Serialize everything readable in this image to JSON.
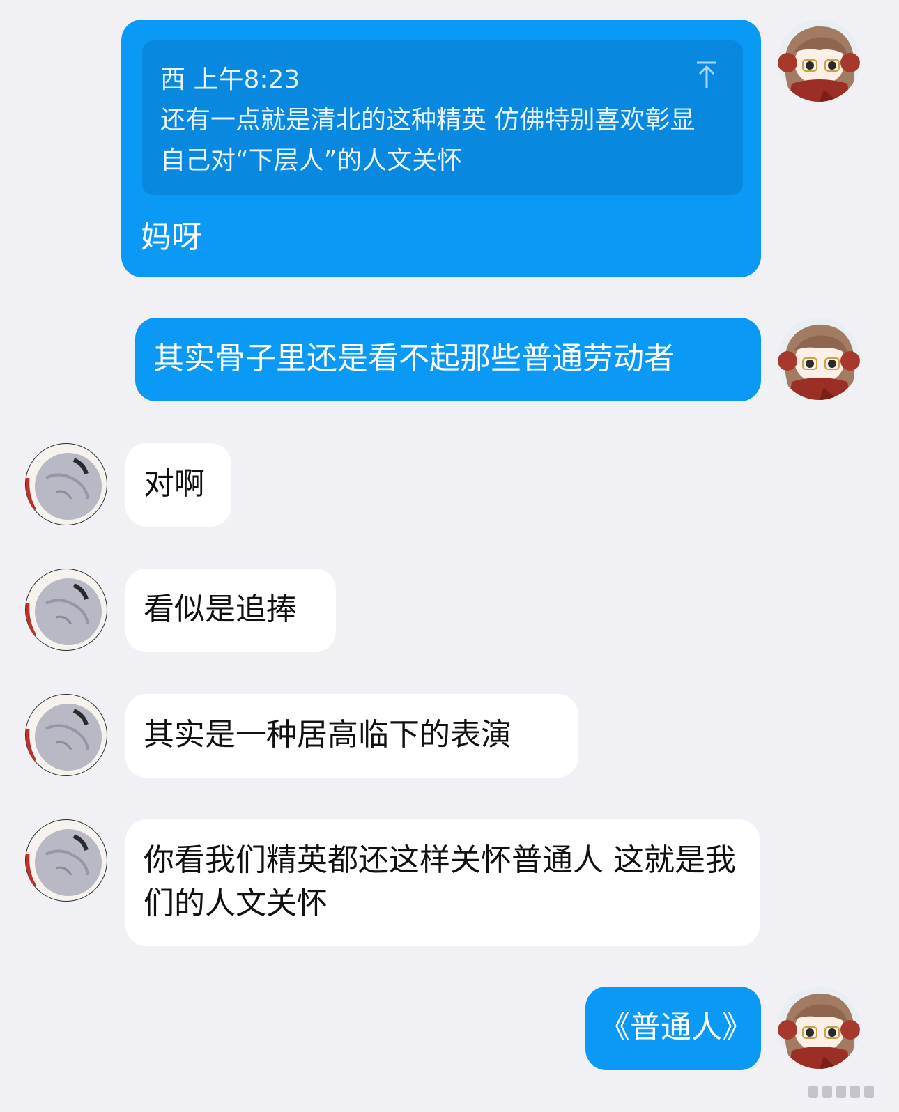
{
  "colors": {
    "background": "#f0f0f5",
    "outgoing_bubble": "#0a9af5",
    "quote_block": "#0888df",
    "incoming_bubble": "#ffffff",
    "incoming_text": "#111111"
  },
  "messages": [
    {
      "side": "outgoing",
      "avatar_icon": "girl-red-scarf-avatar-icon",
      "quote": {
        "sender": "西",
        "time": "上午8:23",
        "text": "还有一点就是清北的这种精英 仿佛特别喜欢彰显自己对“下层人”的人文关怀",
        "icon": "scroll-to-top-icon"
      },
      "text": "妈呀"
    },
    {
      "side": "outgoing",
      "avatar_icon": "girl-red-scarf-avatar-icon",
      "text": "其实骨子里还是看不起那些普通劳动者"
    },
    {
      "side": "incoming",
      "avatar_icon": "gray-plush-avatar-icon",
      "text": "对啊"
    },
    {
      "side": "incoming",
      "avatar_icon": "gray-plush-avatar-icon",
      "text": "看似是追捧"
    },
    {
      "side": "incoming",
      "avatar_icon": "gray-plush-avatar-icon",
      "text": "其实是一种居高临下的表演"
    },
    {
      "side": "incoming",
      "avatar_icon": "gray-plush-avatar-icon",
      "text": "你看我们精英都还这样关怀普通人 这就是我们的人文关怀"
    },
    {
      "side": "outgoing",
      "avatar_icon": "girl-red-scarf-avatar-icon",
      "text": "《普通人》"
    }
  ]
}
